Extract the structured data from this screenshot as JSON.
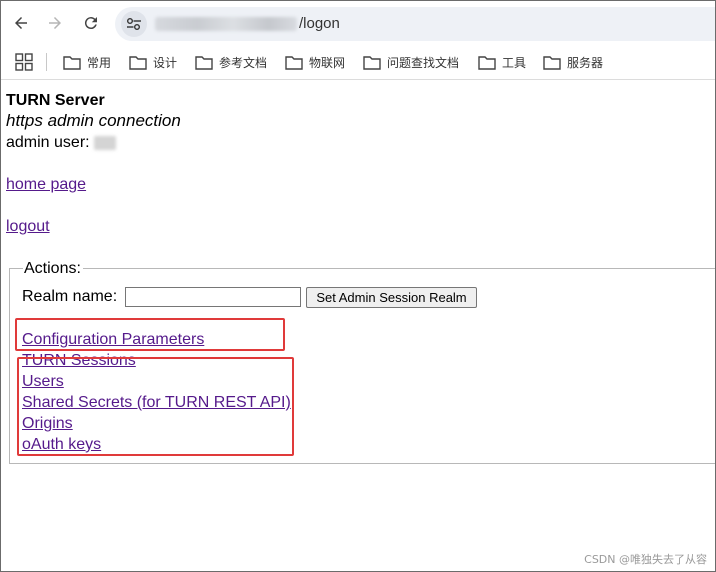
{
  "browser": {
    "url_suffix": "/logon",
    "bookmarks": [
      {
        "label": "常用"
      },
      {
        "label": "设计"
      },
      {
        "label": "参考文档"
      },
      {
        "label": "物联网"
      },
      {
        "label": "问题查找文档"
      },
      {
        "label": "工具"
      },
      {
        "label": "服务器"
      }
    ]
  },
  "page": {
    "title": "TURN Server",
    "subtitle": "https admin connection",
    "admin_user_label": "admin user:",
    "home_link": "home page",
    "logout_link": "logout",
    "actions": {
      "legend": "Actions:",
      "realm_label": "Realm name:",
      "realm_value": "",
      "set_realm_button": "Set Admin Session Realm",
      "links": [
        "Configuration Parameters",
        "TURN Sessions",
        "Users",
        "Shared Secrets (for TURN REST API)",
        "Origins",
        "oAuth keys"
      ]
    }
  },
  "watermark": "CSDN @唯独失去了从容",
  "colors": {
    "link": "#551a8b",
    "highlight": "#e03a3a"
  }
}
